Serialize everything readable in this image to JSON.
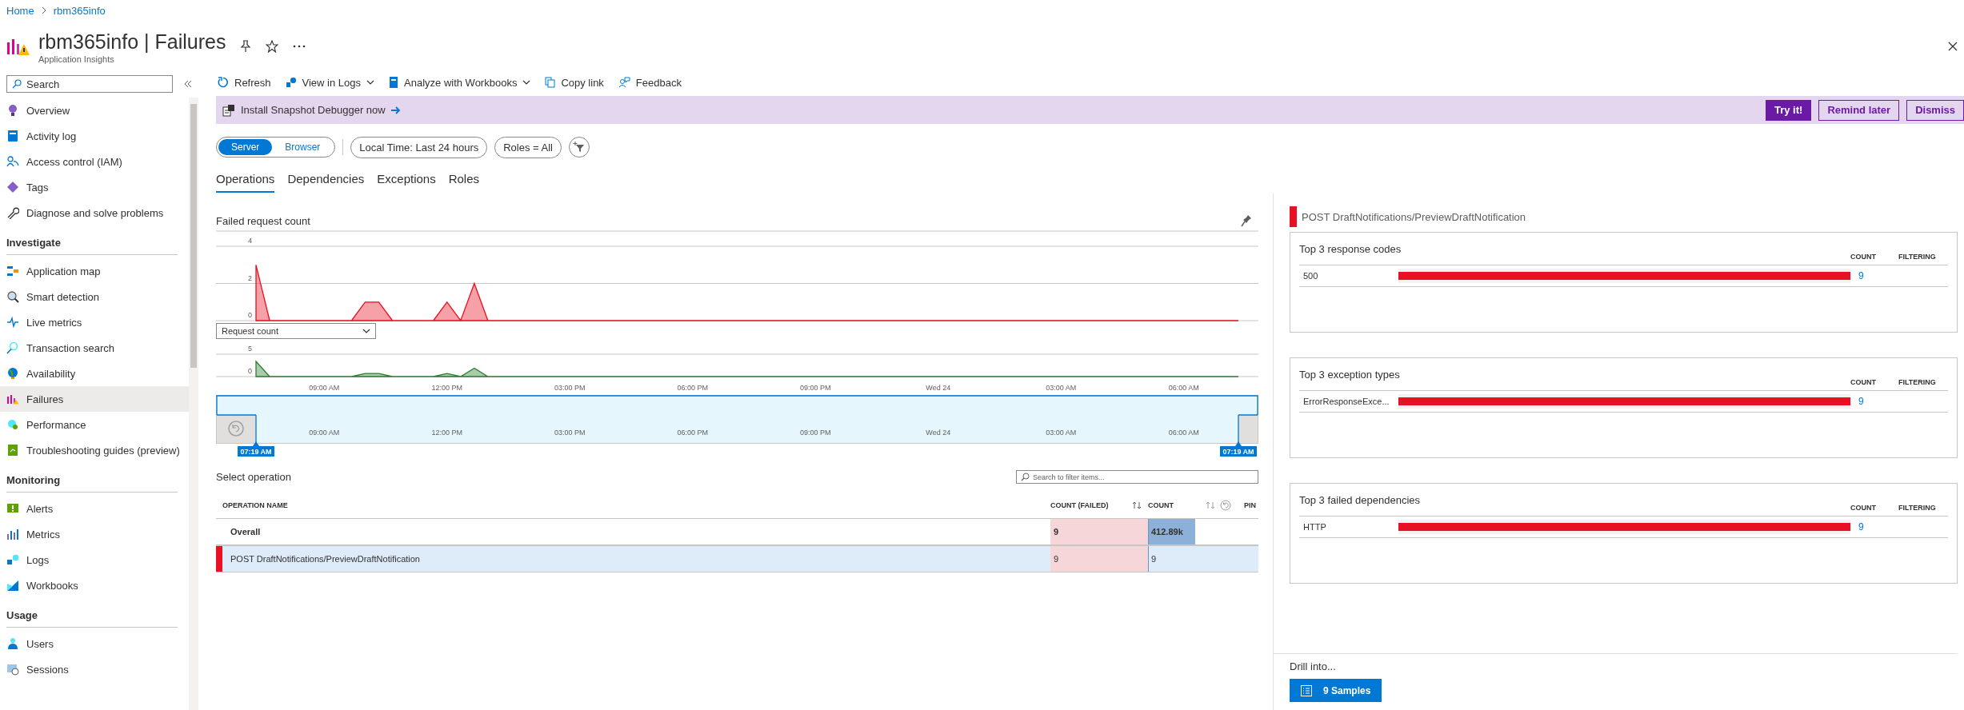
{
  "breadcrumb": [
    "Home",
    "rbm365info"
  ],
  "header": {
    "title": "rbm365info | Failures",
    "subtitle": "Application Insights"
  },
  "sidebar": {
    "search": {
      "placeholder": "Search"
    },
    "sections": [
      {
        "items": [
          {
            "label": "Overview",
            "selected": false
          },
          {
            "label": "Activity log",
            "selected": false
          },
          {
            "label": "Access control (IAM)",
            "selected": false
          },
          {
            "label": "Tags",
            "selected": false
          },
          {
            "label": "Diagnose and solve problems",
            "selected": false
          }
        ]
      },
      {
        "heading": "Investigate",
        "items": [
          {
            "label": "Application map",
            "selected": false
          },
          {
            "label": "Smart detection",
            "selected": false
          },
          {
            "label": "Live metrics",
            "selected": false
          },
          {
            "label": "Transaction search",
            "selected": false
          },
          {
            "label": "Availability",
            "selected": false
          },
          {
            "label": "Failures",
            "selected": true
          },
          {
            "label": "Performance",
            "selected": false
          },
          {
            "label": "Troubleshooting guides (preview)",
            "selected": false
          }
        ]
      },
      {
        "heading": "Monitoring",
        "items": [
          {
            "label": "Alerts",
            "selected": false
          },
          {
            "label": "Metrics",
            "selected": false
          },
          {
            "label": "Logs",
            "selected": false
          },
          {
            "label": "Workbooks",
            "selected": false
          }
        ]
      },
      {
        "heading": "Usage",
        "items": [
          {
            "label": "Users",
            "selected": false
          },
          {
            "label": "Sessions",
            "selected": false
          }
        ]
      }
    ]
  },
  "toolbar": [
    {
      "label": "Refresh",
      "kind": "button"
    },
    {
      "label": "View in Logs",
      "kind": "menu"
    },
    {
      "label": "Analyze with Workbooks",
      "kind": "menu"
    },
    {
      "label": "Copy link",
      "kind": "button"
    },
    {
      "label": "Feedback",
      "kind": "button"
    }
  ],
  "banner": {
    "text": "Install Snapshot Debugger now",
    "buttons": [
      {
        "label": "Try it!",
        "kind": "primary"
      },
      {
        "label": "Remind later",
        "kind": "outline"
      },
      {
        "label": "Dismiss",
        "kind": "outline"
      }
    ]
  },
  "filters": {
    "scope": [
      {
        "label": "Server",
        "selected": true
      },
      {
        "label": "Browser",
        "selected": false
      }
    ],
    "pills": [
      "Local Time: Last 24 hours",
      "Roles = All"
    ]
  },
  "tabs": [
    {
      "label": "Operations",
      "selected": true
    },
    {
      "label": "Dependencies",
      "selected": false
    },
    {
      "label": "Exceptions",
      "selected": false
    },
    {
      "label": "Roles",
      "selected": false
    }
  ],
  "failed_chart": {
    "chart_data": {
      "type": "area",
      "categories": [
        null,
        null,
        null,
        null,
        null,
        null,
        null,
        null,
        null,
        null,
        null,
        null,
        null,
        null,
        null,
        null,
        null,
        null,
        null,
        null,
        null,
        null,
        null,
        null,
        null,
        null,
        null,
        null,
        null,
        null,
        null,
        null,
        null,
        null,
        null,
        null,
        null,
        null,
        null,
        null,
        null,
        null,
        null,
        null,
        null,
        null,
        null,
        null,
        null,
        null,
        null,
        null,
        null,
        null,
        null,
        null,
        null,
        null,
        null,
        null,
        null,
        null,
        null,
        null,
        null,
        null,
        null,
        null,
        null,
        null,
        null,
        null,
        null
      ],
      "ylim": [
        0,
        4
      ],
      "yticks": [
        0,
        2,
        4
      ],
      "series": [
        {
          "name": "Failed request count",
          "color": "#e81123",
          "values": [
            3,
            0,
            0,
            0,
            0,
            0,
            0,
            0,
            1,
            1,
            0,
            0,
            0,
            0,
            1,
            0,
            2,
            0,
            0,
            0,
            0,
            0,
            0,
            0,
            0,
            0,
            0,
            0,
            0,
            0,
            0,
            0,
            0,
            0,
            0,
            0,
            0,
            0,
            0,
            0,
            0,
            0,
            0,
            0,
            0,
            0,
            0,
            0,
            0,
            0,
            0,
            0,
            0,
            0,
            0,
            0,
            0,
            0,
            0,
            0,
            0,
            0,
            0,
            0,
            0,
            0,
            0,
            0,
            0,
            0,
            0,
            0,
            0
          ]
        }
      ]
    }
  },
  "request_chart": {
    "chart_data": {
      "type": "area",
      "categories": [
        null,
        null,
        null,
        null,
        null,
        "09:00 AM",
        null,
        null,
        null,
        null,
        null,
        null,
        null,
        null,
        "12:00 PM",
        null,
        null,
        null,
        null,
        null,
        null,
        null,
        null,
        "03:00 PM",
        null,
        null,
        null,
        null,
        null,
        null,
        null,
        null,
        "06:00 PM",
        null,
        null,
        null,
        null,
        null,
        null,
        null,
        null,
        "09:00 PM",
        null,
        null,
        null,
        null,
        null,
        null,
        null,
        null,
        "Wed 24",
        null,
        null,
        null,
        null,
        null,
        null,
        null,
        null,
        "03:00 AM",
        null,
        null,
        null,
        null,
        null,
        null,
        null,
        null,
        "06:00 AM",
        null,
        null,
        null,
        null
      ],
      "ylim": [
        0,
        5
      ],
      "yticks": [
        0,
        5
      ],
      "series": [
        {
          "name": "Request count",
          "color": "#2e7d32",
          "values": [
            3.4,
            0,
            0,
            0,
            0,
            0,
            0,
            0,
            0.7,
            0.7,
            0,
            0,
            0,
            0,
            0.7,
            0,
            1.9,
            0,
            0,
            0,
            0,
            0,
            0,
            0,
            0,
            0,
            0,
            0,
            0,
            0,
            0,
            0,
            0,
            0,
            0,
            0,
            0,
            0,
            0,
            0,
            0,
            0,
            0,
            0,
            0,
            0,
            0,
            0,
            0,
            0,
            0,
            0,
            0,
            0,
            0,
            0,
            0,
            0,
            0,
            0,
            0,
            0,
            0,
            0,
            0,
            0,
            0,
            0,
            0,
            0,
            0,
            0,
            0
          ]
        }
      ]
    }
  },
  "brush": {
    "ticks": [
      "09:00 AM",
      "12:00 PM",
      "03:00 PM",
      "06:00 PM",
      "09:00 PM",
      "Wed 24",
      "03:00 AM",
      "06:00 AM"
    ],
    "start": "07:19 AM",
    "end": "07:19 AM"
  },
  "operations": {
    "title": "Select operation",
    "search": {
      "placeholder": "Search to filter items..."
    },
    "columns": [
      "OPERATION NAME",
      "COUNT (FAILED)",
      "COUNT",
      "PIN"
    ],
    "rows": [
      {
        "name": "Overall",
        "kind": "total",
        "failed": "9",
        "count": "412.89k",
        "level": 1,
        "selected": false
      },
      {
        "name": "POST DraftNotifications/PreviewDraftNotification",
        "kind": "operation",
        "failed": "9",
        "count": "9",
        "level": 0,
        "selected": true
      }
    ]
  },
  "details": {
    "title": "POST DraftNotifications/PreviewDraftNotification",
    "cards": [
      {
        "title": "Top 3 response codes",
        "columns": [
          "COUNT",
          "FILTERING"
        ],
        "rows": [
          {
            "label": "500",
            "level": 1,
            "count": "9"
          }
        ]
      },
      {
        "title": "Top 3 exception types",
        "columns": [
          "COUNT",
          "FILTERING"
        ],
        "rows": [
          {
            "label": "ErrorResponseExce...",
            "level": 1,
            "count": "9"
          }
        ]
      },
      {
        "title": "Top 3 failed dependencies",
        "columns": [
          "COUNT",
          "FILTERING"
        ],
        "rows": [
          {
            "label": "HTTP",
            "level": 1,
            "count": "9"
          }
        ]
      }
    ],
    "drill": {
      "label": "Drill into...",
      "button": "9 Samples"
    }
  }
}
